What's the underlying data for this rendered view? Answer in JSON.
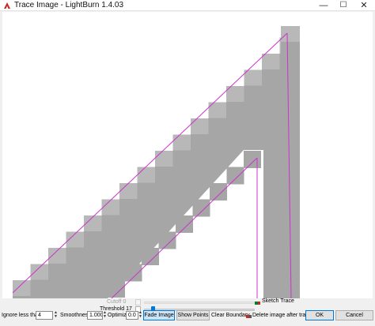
{
  "window": {
    "title": "Trace Image - LightBurn 1.4.03",
    "minimize_glyph": "—",
    "maximize_glyph": "☐",
    "close_glyph": "✕",
    "app_icon": "lightburn-logo-icon"
  },
  "canvas": {
    "preview": "traced staircase shape with magenta trace outline",
    "fill_color": "#a6a6a6",
    "trace_color": "#cc33cc"
  },
  "controls": {
    "cutoff_label": "Cutoff",
    "cutoff_value": "0",
    "threshold_label": "Threshold",
    "threshold_value": "17",
    "threshold_level": 0.07,
    "sketch_trace_label": "Sketch Trace",
    "sketch_trace_checked": true,
    "ignore_label": "Ignore less than",
    "ignore_value": "4",
    "smoothness_label": "Smoothness",
    "smoothness_value": "1.000",
    "optimize_label": "Optimize",
    "optimize_value": "0.0",
    "fade_image_label": "Fade Image",
    "show_points_label": "Show Points",
    "clear_boundary_label": "Clear Boundary",
    "delete_after_label": "Delete image after trace",
    "delete_after_checked": true,
    "ok_label": "OK",
    "cancel_label": "Cancel",
    "stepper_up": "▲",
    "stepper_down": "▼"
  }
}
